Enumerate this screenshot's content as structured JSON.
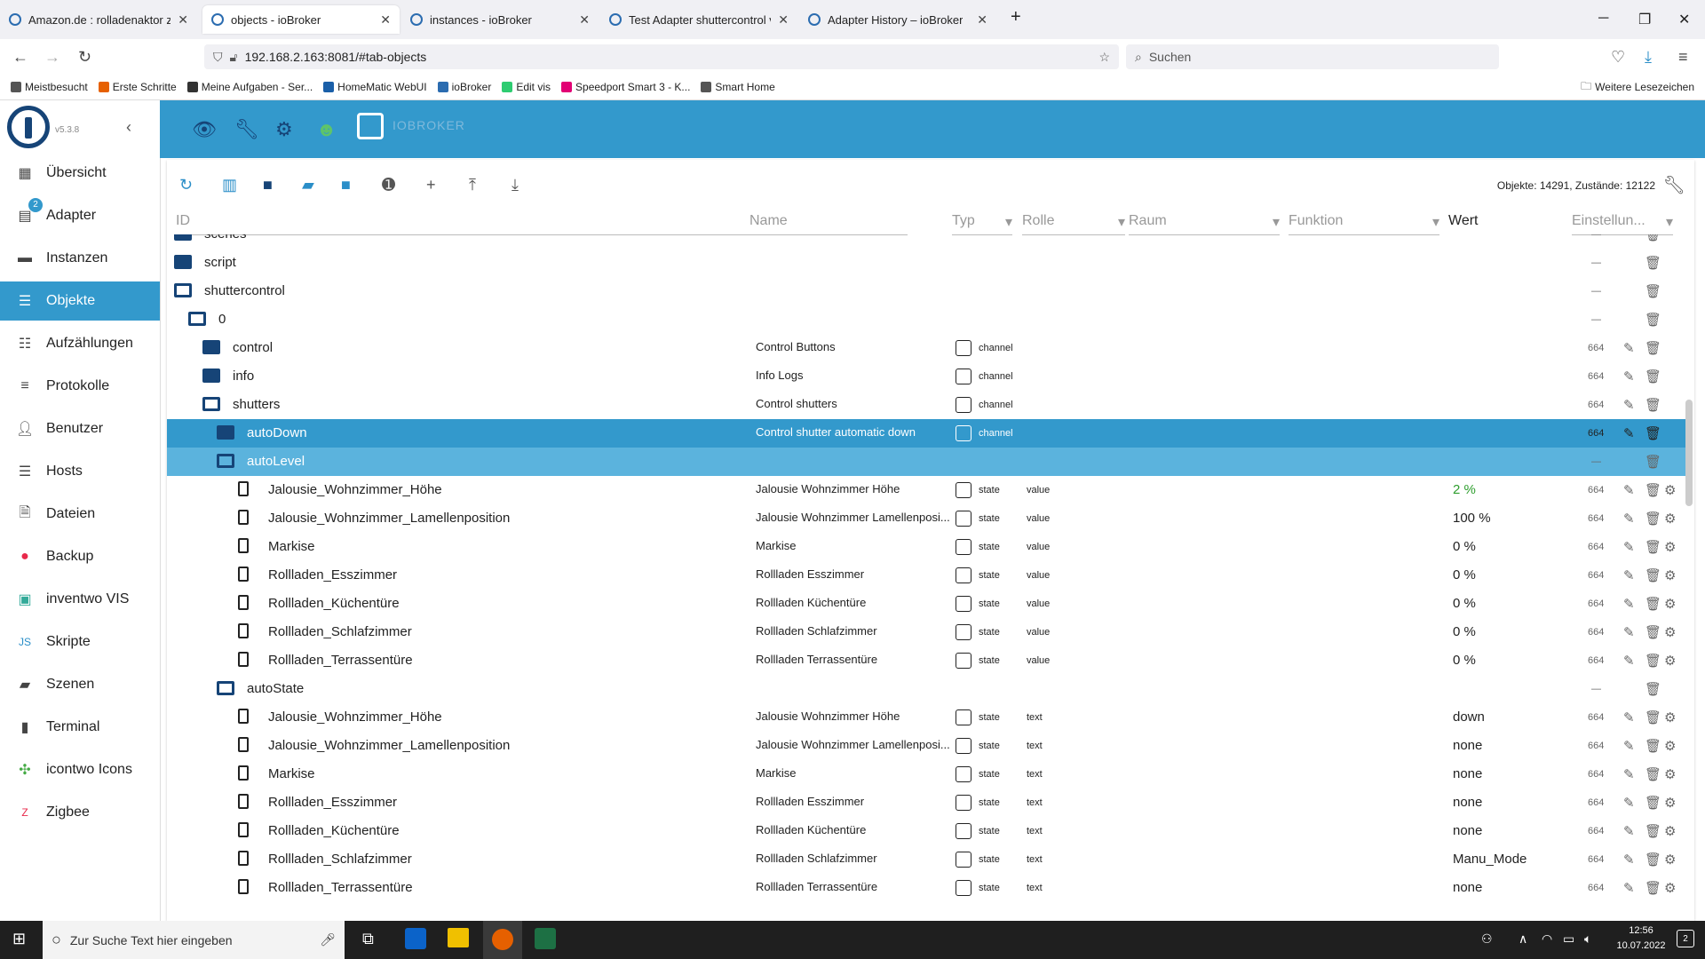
{
  "browser": {
    "tabs": [
      {
        "label": "Amazon.de : rolladenaktor zigb...",
        "active": false
      },
      {
        "label": "objects - ioBroker",
        "active": true
      },
      {
        "label": "instances - ioBroker",
        "active": false
      },
      {
        "label": "Test Adapter shuttercontrol v1.4...",
        "active": false
      },
      {
        "label": "Adapter History – ioBroker",
        "active": false
      }
    ],
    "url": "192.168.2.163:8081/#tab-objects",
    "search_placeholder": "Suchen",
    "bookmarks": [
      "Meistbesucht",
      "Erste Schritte",
      "Meine Aufgaben - Ser...",
      "HomeMatic WebUI",
      "ioBroker",
      "Edit vis",
      "Speedport Smart 3 - K...",
      "Smart Home"
    ],
    "bookmarks_right": "Weitere Lesezeichen"
  },
  "app": {
    "version": "v5.3.8",
    "brand": "IOBROKER",
    "sidebar": [
      {
        "label": "Übersicht",
        "icon": "grid-icon"
      },
      {
        "label": "Adapter",
        "icon": "store-icon",
        "badge": "2"
      },
      {
        "label": "Instanzen",
        "icon": "instances-icon"
      },
      {
        "label": "Objekte",
        "icon": "list-icon",
        "active": true
      },
      {
        "label": "Aufzählungen",
        "icon": "enum-icon"
      },
      {
        "label": "Protokolle",
        "icon": "log-icon"
      },
      {
        "label": "Benutzer",
        "icon": "user-icon"
      },
      {
        "label": "Hosts",
        "icon": "host-icon"
      },
      {
        "label": "Dateien",
        "icon": "file-icon"
      },
      {
        "label": "Backup",
        "icon": "backup-icon"
      },
      {
        "label": "inventwo VIS",
        "icon": "vis-icon"
      },
      {
        "label": "Skripte",
        "icon": "js-icon"
      },
      {
        "label": "Szenen",
        "icon": "scene-icon"
      },
      {
        "label": "Terminal",
        "icon": "terminal-icon"
      },
      {
        "label": "icontwo Icons",
        "icon": "icontwo-icon"
      },
      {
        "label": "Zigbee",
        "icon": "zigbee-icon"
      }
    ],
    "stats": "Objekte: 14291, Zustände: 12122",
    "headers": {
      "id": "ID",
      "name": "Name",
      "type": "Typ",
      "role": "Rolle",
      "room": "Raum",
      "function": "Funktion",
      "value": "Wert",
      "settings": "Einstellun..."
    },
    "rows": [
      {
        "indent": 0,
        "kind": "folder",
        "id": "scenes",
        "partial": true
      },
      {
        "indent": 0,
        "kind": "folder",
        "id": "script"
      },
      {
        "indent": 0,
        "kind": "folder-open",
        "id": "shuttercontrol"
      },
      {
        "indent": 1,
        "kind": "folder-open",
        "id": "0"
      },
      {
        "indent": 2,
        "kind": "folder",
        "id": "control",
        "name": "Control Buttons",
        "type": "channel",
        "perm": "664"
      },
      {
        "indent": 2,
        "kind": "folder",
        "id": "info",
        "name": "Info Logs",
        "type": "channel",
        "perm": "664"
      },
      {
        "indent": 2,
        "kind": "folder-open",
        "id": "shutters",
        "name": "Control shutters",
        "type": "channel",
        "perm": "664"
      },
      {
        "indent": 3,
        "kind": "folder",
        "id": "autoDown",
        "name": "Control shutter automatic down",
        "type": "channel",
        "perm": "664",
        "sel": "sel"
      },
      {
        "indent": 3,
        "kind": "folder-open",
        "id": "autoLevel",
        "sel": "sel2"
      },
      {
        "indent": 4,
        "kind": "file",
        "id": "Jalousie_Wohnzimmer_Höhe",
        "name": "Jalousie Wohnzimmer Höhe",
        "type": "state",
        "role": "value",
        "value": "2 %",
        "green": true,
        "perm": "664"
      },
      {
        "indent": 4,
        "kind": "file",
        "id": "Jalousie_Wohnzimmer_Lamellenposition",
        "name": "Jalousie Wohnzimmer Lamellenposi...",
        "type": "state",
        "role": "value",
        "value": "100 %",
        "perm": "664"
      },
      {
        "indent": 4,
        "kind": "file",
        "id": "Markise",
        "name": "Markise",
        "type": "state",
        "role": "value",
        "value": "0 %",
        "perm": "664"
      },
      {
        "indent": 4,
        "kind": "file",
        "id": "Rollladen_Esszimmer",
        "name": "Rollladen Esszimmer",
        "type": "state",
        "role": "value",
        "value": "0 %",
        "perm": "664"
      },
      {
        "indent": 4,
        "kind": "file",
        "id": "Rollladen_Küchentüre",
        "name": "Rollladen Küchentüre",
        "type": "state",
        "role": "value",
        "value": "0 %",
        "perm": "664"
      },
      {
        "indent": 4,
        "kind": "file",
        "id": "Rollladen_Schlafzimmer",
        "name": "Rollladen Schlafzimmer",
        "type": "state",
        "role": "value",
        "value": "0 %",
        "perm": "664"
      },
      {
        "indent": 4,
        "kind": "file",
        "id": "Rollladen_Terrassentüre",
        "name": "Rollladen Terrassentüre",
        "type": "state",
        "role": "value",
        "value": "0 %",
        "perm": "664"
      },
      {
        "indent": 3,
        "kind": "folder-open",
        "id": "autoState"
      },
      {
        "indent": 4,
        "kind": "file",
        "id": "Jalousie_Wohnzimmer_Höhe",
        "name": "Jalousie Wohnzimmer Höhe",
        "type": "state",
        "role": "text",
        "value": "down",
        "perm": "664"
      },
      {
        "indent": 4,
        "kind": "file",
        "id": "Jalousie_Wohnzimmer_Lamellenposition",
        "name": "Jalousie Wohnzimmer Lamellenposi...",
        "type": "state",
        "role": "text",
        "value": "none",
        "perm": "664"
      },
      {
        "indent": 4,
        "kind": "file",
        "id": "Markise",
        "name": "Markise",
        "type": "state",
        "role": "text",
        "value": "none",
        "perm": "664"
      },
      {
        "indent": 4,
        "kind": "file",
        "id": "Rollladen_Esszimmer",
        "name": "Rollladen Esszimmer",
        "type": "state",
        "role": "text",
        "value": "none",
        "perm": "664"
      },
      {
        "indent": 4,
        "kind": "file",
        "id": "Rollladen_Küchentüre",
        "name": "Rollladen Küchentüre",
        "type": "state",
        "role": "text",
        "value": "none",
        "perm": "664"
      },
      {
        "indent": 4,
        "kind": "file",
        "id": "Rollladen_Schlafzimmer",
        "name": "Rollladen Schlafzimmer",
        "type": "state",
        "role": "text",
        "value": "Manu_Mode",
        "perm": "664"
      },
      {
        "indent": 4,
        "kind": "file",
        "id": "Rollladen_Terrassentüre",
        "name": "Rollladen Terrassentüre",
        "type": "state",
        "role": "text",
        "value": "none",
        "perm": "664"
      }
    ]
  },
  "taskbar": {
    "search_placeholder": "Zur Suche Text hier eingeben",
    "time": "12:56",
    "date": "10.07.2022",
    "notif_count": "2"
  },
  "colors": {
    "accent": "#3399cc",
    "dark": "#164477",
    "green": "#2e9e2e"
  }
}
